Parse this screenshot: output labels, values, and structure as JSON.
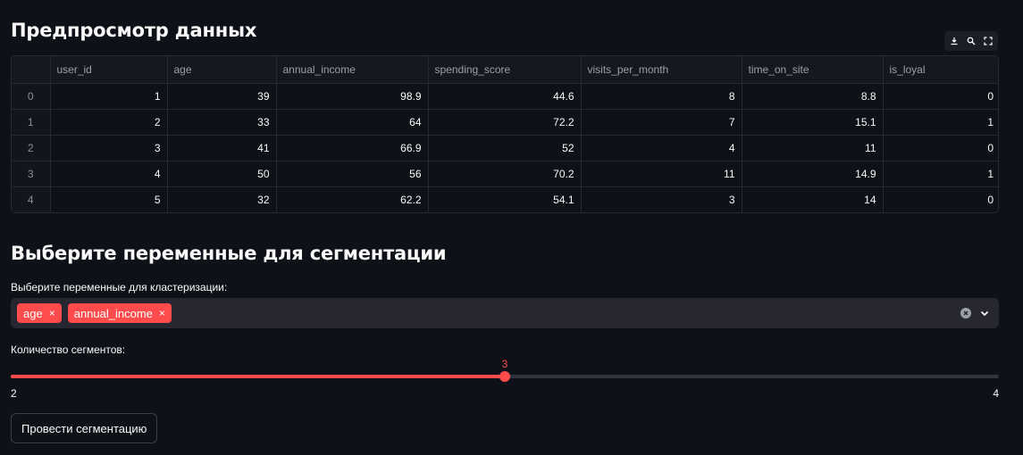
{
  "preview": {
    "title": "Предпросмотр данных",
    "toolbar": {
      "download_icon": "download-icon",
      "search_icon": "search-icon",
      "fullscreen_icon": "fullscreen-icon"
    },
    "table": {
      "columns": [
        "",
        "user_id",
        "age",
        "annual_income",
        "spending_score",
        "visits_per_month",
        "time_on_site",
        "is_loyal"
      ],
      "rows": [
        [
          "0",
          "1",
          "39",
          "98.9",
          "44.6",
          "8",
          "8.8",
          "0"
        ],
        [
          "1",
          "2",
          "33",
          "64",
          "72.2",
          "7",
          "15.1",
          "1"
        ],
        [
          "2",
          "3",
          "41",
          "66.9",
          "52",
          "4",
          "11",
          "0"
        ],
        [
          "3",
          "4",
          "50",
          "56",
          "70.2",
          "11",
          "14.9",
          "1"
        ],
        [
          "4",
          "5",
          "32",
          "62.2",
          "54.1",
          "3",
          "14",
          "0"
        ]
      ]
    }
  },
  "segmentation": {
    "title": "Выберите переменные для сегментации",
    "multiselect": {
      "label": "Выберите переменные для кластеризации:",
      "selected": [
        "age",
        "annual_income"
      ],
      "tag_remove_glyph": "×"
    },
    "slider": {
      "label": "Количество сегментов:",
      "min": 2,
      "max": 4,
      "value": 3
    },
    "button_label": "Провести сегментацию"
  },
  "colors": {
    "accent": "#ff4b4b",
    "background": "#0e1117",
    "input_background": "#262730"
  }
}
